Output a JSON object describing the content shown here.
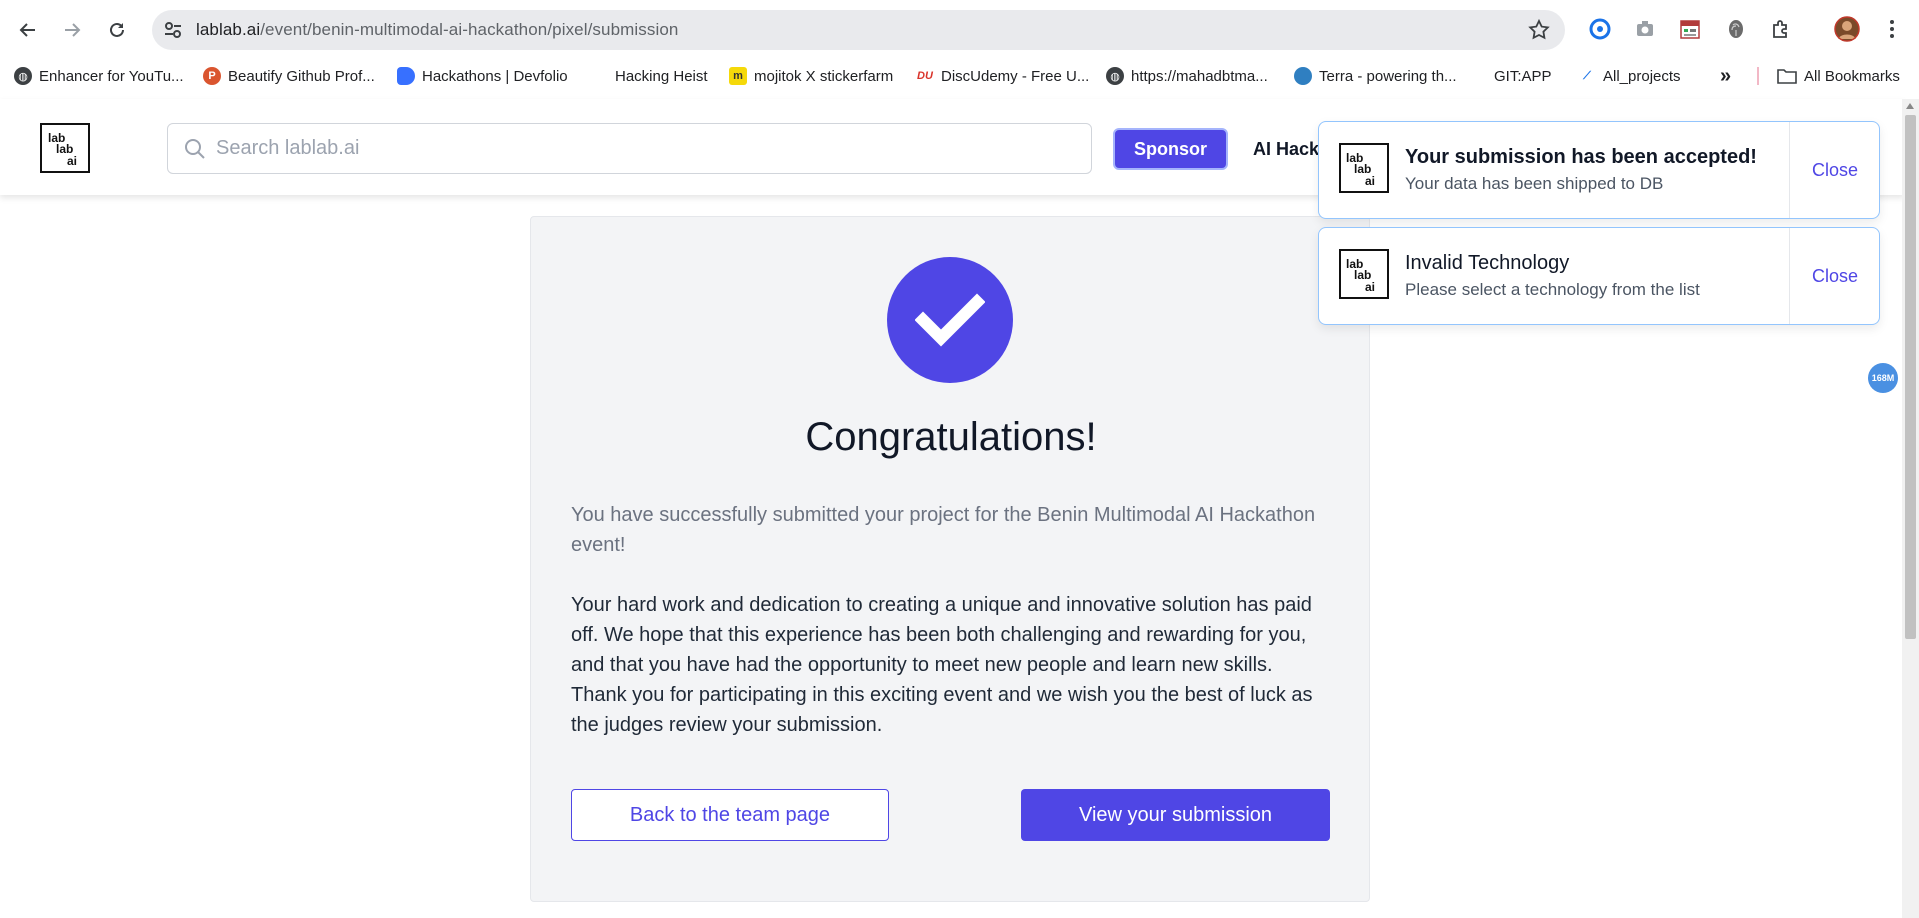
{
  "browser": {
    "url_domain": "lablab.ai",
    "url_path": "/event/benin-multimodal-ai-hackathon/pixel/submission",
    "bookmarks": [
      {
        "label": "Enhancer for YouTu...",
        "icon": "globe-icon"
      },
      {
        "label": "Beautify Github Prof...",
        "icon": "producthunt-icon"
      },
      {
        "label": "Hackathons | Devfolio",
        "icon": "devfolio-icon"
      },
      {
        "label": "Hacking Heist",
        "icon": "blank-icon"
      },
      {
        "label": "mojitok X stickerfarm",
        "icon": "mojitok-icon"
      },
      {
        "label": "DiscUdemy - Free U...",
        "icon": "discudemy-icon"
      },
      {
        "label": "https://mahadbtma...",
        "icon": "globe-icon"
      },
      {
        "label": "Terra - powering th...",
        "icon": "terra-icon"
      },
      {
        "label": "GIT:APP",
        "icon": "blank-icon"
      },
      {
        "label": "All_projects",
        "icon": "projects-icon"
      }
    ],
    "all_bookmarks_label": "All Bookmarks",
    "overflow_label": "»"
  },
  "header": {
    "logo_lines": [
      "lab",
      "lab",
      "ai"
    ],
    "search_placeholder": "Search lablab.ai",
    "sponsor_label": "Sponsor",
    "nav_link_label": "AI Hack"
  },
  "main": {
    "title": "Congratulations!",
    "intro": "You have successfully submitted your project for the Benin Multimodal AI Hackathon event!",
    "body": "Your hard work and dedication to creating a unique and innovative solution has paid off. We hope that this experience has been both challenging and rewarding for you, and that you have had the opportunity to meet new people and learn new skills. Thank you for participating in this exciting event and we wish you the best of luck as the judges review your submission.",
    "back_button_label": "Back to the team page",
    "view_button_label": "View your submission"
  },
  "toasts": [
    {
      "title": "Your submission has been accepted!",
      "message": "Your data has been shipped to DB",
      "close_label": "Close"
    },
    {
      "title": "Invalid Technology",
      "message": "Please select a technology from the list",
      "close_label": "Close"
    }
  ],
  "memory_badge": "168M",
  "colors": {
    "accent": "#4f46e5",
    "toast_border": "#93c5fd",
    "card_bg": "#f3f4f6"
  }
}
